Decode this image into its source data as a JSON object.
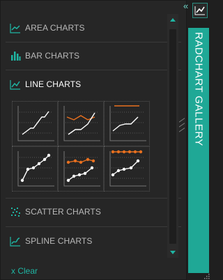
{
  "menu": {
    "items": [
      {
        "label": "AREA CHARTS",
        "icon": "area-chart-icon"
      },
      {
        "label": "BAR CHARTS",
        "icon": "bar-chart-icon"
      },
      {
        "label": "LINE CHARTS",
        "icon": "line-chart-icon"
      },
      {
        "label": "SCATTER CHARTS",
        "icon": "scatter-chart-icon"
      },
      {
        "label": "SPLINE CHARTS",
        "icon": "spline-chart-icon"
      }
    ],
    "active": "LINE CHARTS"
  },
  "gallery_thumbnails": [
    "line-simple",
    "line-with-orange-series",
    "line-with-orange-reference",
    "line-markers",
    "line-markers-orange-series",
    "line-markers-orange-reference"
  ],
  "footer": {
    "clear_label": "x Clear"
  },
  "sidebar_tab": {
    "title": "RADCHART GALLERY",
    "collapse_glyph": "«"
  },
  "colors": {
    "accent": "#1fb5a3",
    "orange": "#e8701f",
    "background": "#262626"
  }
}
